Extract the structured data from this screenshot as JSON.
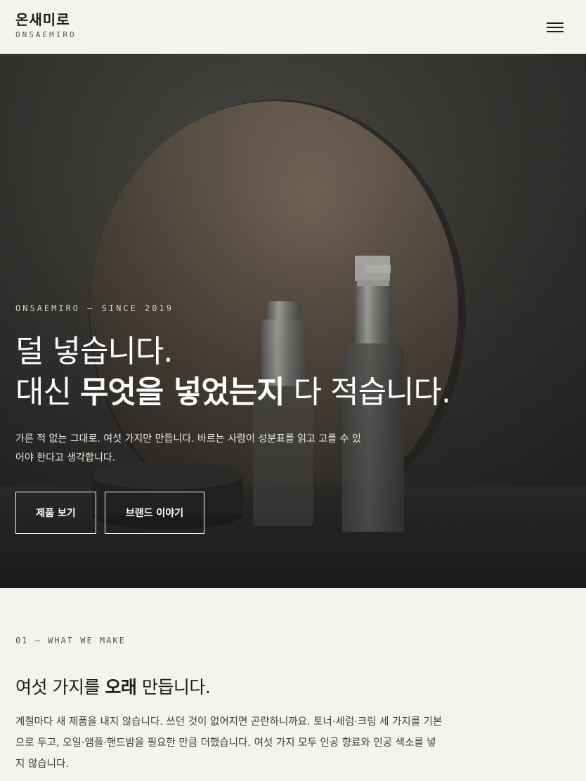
{
  "header": {
    "logo_ko": "온새미로",
    "logo_en": "ONSAEMIRO",
    "menu_icon": "hamburger-icon"
  },
  "hero": {
    "eyebrow": "ONSAEMIRO — SINCE 2019",
    "title_line1": "덜 넣습니다.",
    "title_line2_pre": "대신 ",
    "title_line2_bold": "무엇을 넣었는지",
    "title_line2_post": " 다 적습니다.",
    "description": "가른 적 없는 그대로. 여섯 가지만 만듭니다. 바르는 사람이 성분표를 읽고 고를 수 있어야 한다고 생각합니다.",
    "button_products": "제품 보기",
    "button_story": "브랜드 이야기"
  },
  "section_make": {
    "eyebrow": "01 — WHAT WE MAKE",
    "title_pre": "여섯 가지를 ",
    "title_bold": "오래",
    "title_post": " 만듭니다.",
    "description": "계절마다 새 제품을 내지 않습니다. 쓰던 것이 없어지면 곤란하니까요. 토너·세럼·크림 세 가지를 기본으로 두고, 오일·앰플·핸드밤을 필요한 만큼 더했습니다. 여섯 가지 모두 인공 향료와 인공 색소를 넣지 않습니다."
  },
  "colors": {
    "page_bg": "#f3f3ef",
    "text": "#1c1c1a",
    "hero_text": "#ffffff"
  }
}
